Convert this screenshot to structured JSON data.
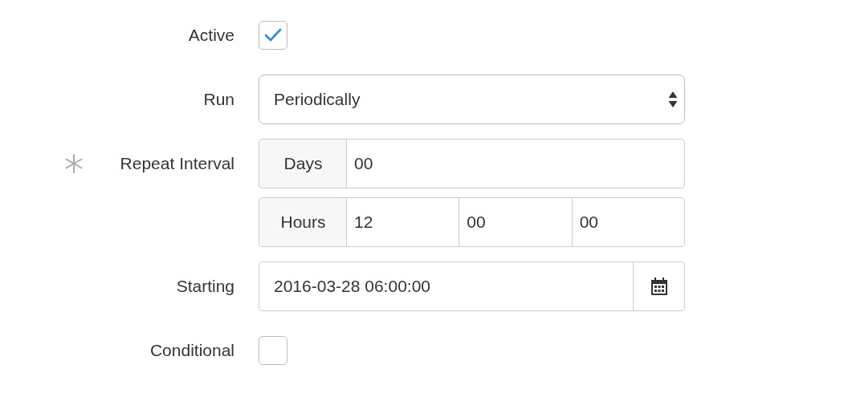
{
  "fields": [
    {
      "kind": "checkbox",
      "label": "Active",
      "checked": true
    },
    {
      "kind": "select",
      "label": "Run",
      "value": "Periodically"
    },
    {
      "kind": "interval",
      "label": "Repeat Interval",
      "required": true,
      "groups": [
        {
          "unit": "Days",
          "values": [
            "00"
          ]
        },
        {
          "unit": "Hours",
          "values": [
            "12",
            "00",
            "00"
          ]
        }
      ]
    },
    {
      "kind": "datetime",
      "label": "Starting",
      "value": "2016-03-28 06:00:00"
    },
    {
      "kind": "checkbox",
      "label": "Conditional",
      "checked": false
    }
  ]
}
